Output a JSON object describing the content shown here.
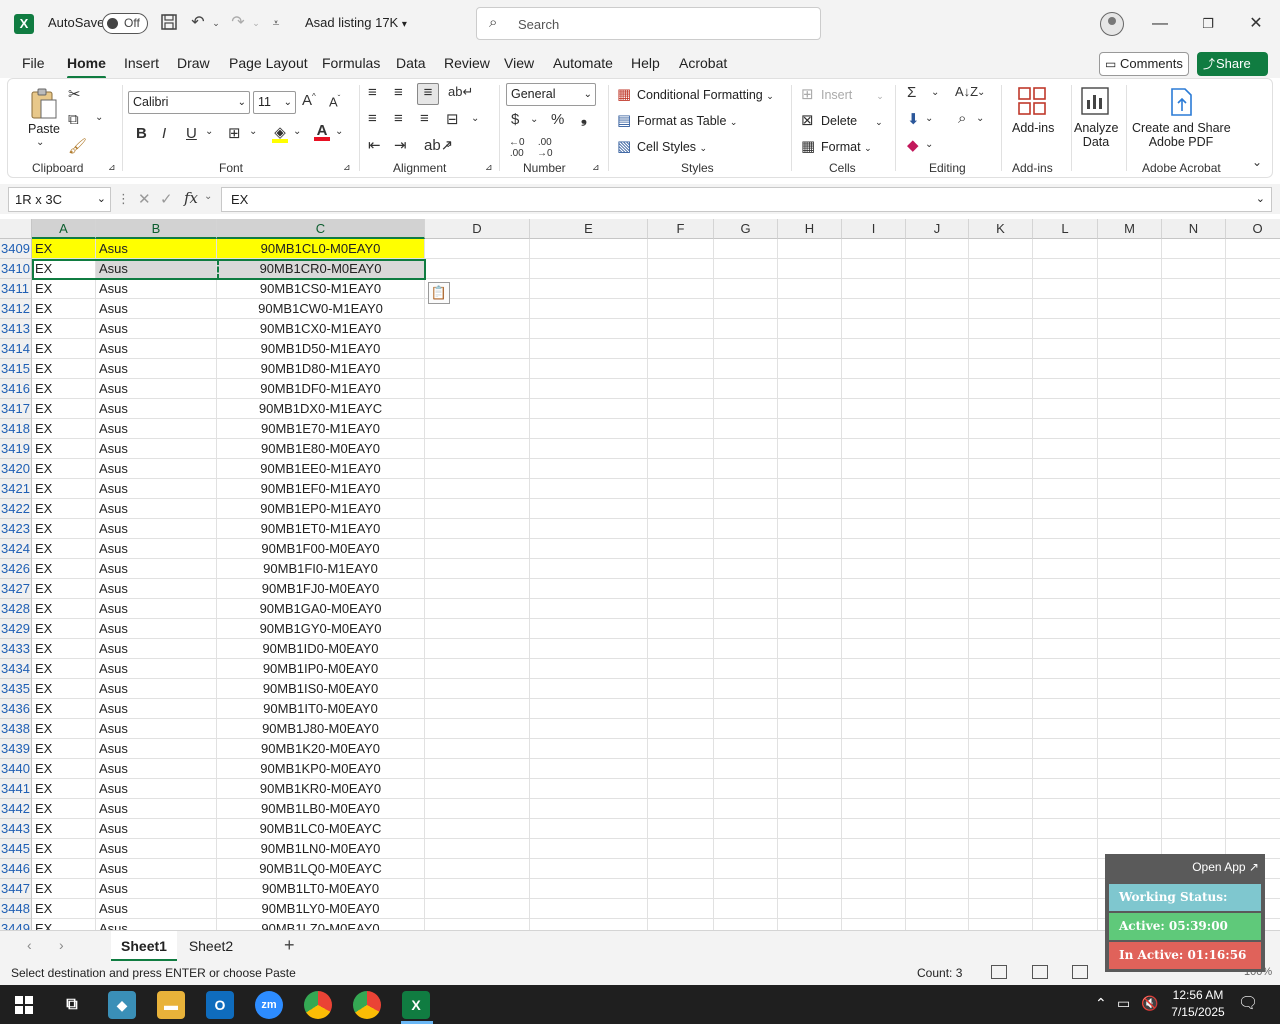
{
  "titlebar": {
    "autosave_label": "AutoSave",
    "autosave_state": "Off",
    "doc_title": "Asad listing 17K",
    "search_placeholder": "Search"
  },
  "menu": {
    "tabs": [
      "File",
      "Home",
      "Insert",
      "Draw",
      "Page Layout",
      "Formulas",
      "Data",
      "Review",
      "View",
      "Automate",
      "Help",
      "Acrobat"
    ],
    "active_tab": "Home",
    "comments_label": "Comments",
    "share_label": "Share"
  },
  "ribbon": {
    "clipboard": {
      "paste_label": "Paste",
      "group_label": "Clipboard"
    },
    "font": {
      "font_name": "Calibri",
      "font_size": "11",
      "group_label": "Font"
    },
    "alignment": {
      "group_label": "Alignment"
    },
    "number": {
      "format": "General",
      "group_label": "Number"
    },
    "styles": {
      "conditional": "Conditional Formatting",
      "format_table": "Format as Table",
      "cell_styles": "Cell Styles",
      "group_label": "Styles"
    },
    "cells": {
      "insert": "Insert",
      "delete": "Delete",
      "format": "Format",
      "group_label": "Cells"
    },
    "editing": {
      "group_label": "Editing"
    },
    "addins": {
      "label": "Add-ins",
      "group_label": "Add-ins"
    },
    "analyze": {
      "label_line1": "Analyze",
      "label_line2": "Data"
    },
    "acrobat": {
      "label_line1": "Create and Share",
      "label_line2": "Adobe PDF",
      "group_label": "Adobe Acrobat"
    }
  },
  "formula_bar": {
    "name_box": "1R x 3C",
    "fx": "fx",
    "value": "EX"
  },
  "columns": [
    "A",
    "B",
    "C",
    "D",
    "E",
    "F",
    "G",
    "H",
    "I",
    "J",
    "K",
    "L",
    "M",
    "N",
    "O"
  ],
  "rows": [
    {
      "n": "3409",
      "a": "EX",
      "b": "Asus",
      "c": "90MB1CL0-M0EAY0"
    },
    {
      "n": "3410",
      "a": "EX",
      "b": "Asus",
      "c": "90MB1CR0-M0EAY0"
    },
    {
      "n": "3411",
      "a": "EX",
      "b": "Asus",
      "c": "90MB1CS0-M1EAY0"
    },
    {
      "n": "3412",
      "a": "EX",
      "b": "Asus",
      "c": "90MB1CW0-M1EAY0"
    },
    {
      "n": "3413",
      "a": "EX",
      "b": "Asus",
      "c": "90MB1CX0-M1EAY0"
    },
    {
      "n": "3414",
      "a": "EX",
      "b": "Asus",
      "c": "90MB1D50-M1EAY0"
    },
    {
      "n": "3415",
      "a": "EX",
      "b": "Asus",
      "c": "90MB1D80-M1EAY0"
    },
    {
      "n": "3416",
      "a": "EX",
      "b": "Asus",
      "c": "90MB1DF0-M1EAY0"
    },
    {
      "n": "3417",
      "a": "EX",
      "b": "Asus",
      "c": "90MB1DX0-M1EAYC"
    },
    {
      "n": "3418",
      "a": "EX",
      "b": "Asus",
      "c": "90MB1E70-M1EAY0"
    },
    {
      "n": "3419",
      "a": "EX",
      "b": "Asus",
      "c": "90MB1E80-M0EAY0"
    },
    {
      "n": "3420",
      "a": "EX",
      "b": "Asus",
      "c": "90MB1EE0-M1EAY0"
    },
    {
      "n": "3421",
      "a": "EX",
      "b": "Asus",
      "c": "90MB1EF0-M1EAY0"
    },
    {
      "n": "3422",
      "a": "EX",
      "b": "Asus",
      "c": "90MB1EP0-M1EAY0"
    },
    {
      "n": "3423",
      "a": "EX",
      "b": "Asus",
      "c": "90MB1ET0-M1EAY0"
    },
    {
      "n": "3424",
      "a": "EX",
      "b": "Asus",
      "c": "90MB1F00-M0EAY0"
    },
    {
      "n": "3426",
      "a": "EX",
      "b": "Asus",
      "c": "90MB1FI0-M1EAY0"
    },
    {
      "n": "3427",
      "a": "EX",
      "b": "Asus",
      "c": "90MB1FJ0-M0EAY0"
    },
    {
      "n": "3428",
      "a": "EX",
      "b": "Asus",
      "c": "90MB1GA0-M0EAY0"
    },
    {
      "n": "3429",
      "a": "EX",
      "b": "Asus",
      "c": "90MB1GY0-M0EAY0"
    },
    {
      "n": "3433",
      "a": "EX",
      "b": "Asus",
      "c": "90MB1ID0-M0EAY0"
    },
    {
      "n": "3434",
      "a": "EX",
      "b": "Asus",
      "c": "90MB1IP0-M0EAY0"
    },
    {
      "n": "3435",
      "a": "EX",
      "b": "Asus",
      "c": "90MB1IS0-M0EAY0"
    },
    {
      "n": "3436",
      "a": "EX",
      "b": "Asus",
      "c": "90MB1IT0-M0EAY0"
    },
    {
      "n": "3438",
      "a": "EX",
      "b": "Asus",
      "c": "90MB1J80-M0EAY0"
    },
    {
      "n": "3439",
      "a": "EX",
      "b": "Asus",
      "c": "90MB1K20-M0EAY0"
    },
    {
      "n": "3440",
      "a": "EX",
      "b": "Asus",
      "c": "90MB1KP0-M0EAY0"
    },
    {
      "n": "3441",
      "a": "EX",
      "b": "Asus",
      "c": "90MB1KR0-M0EAY0"
    },
    {
      "n": "3442",
      "a": "EX",
      "b": "Asus",
      "c": "90MB1LB0-M0EAY0"
    },
    {
      "n": "3443",
      "a": "EX",
      "b": "Asus",
      "c": "90MB1LC0-M0EAYC"
    },
    {
      "n": "3445",
      "a": "EX",
      "b": "Asus",
      "c": "90MB1LN0-M0EAY0"
    },
    {
      "n": "3446",
      "a": "EX",
      "b": "Asus",
      "c": "90MB1LQ0-M0EAYC"
    },
    {
      "n": "3447",
      "a": "EX",
      "b": "Asus",
      "c": "90MB1LT0-M0EAY0"
    },
    {
      "n": "3448",
      "a": "EX",
      "b": "Asus",
      "c": "90MB1LY0-M0EAY0"
    },
    {
      "n": "3449",
      "a": "EX",
      "b": "Asus",
      "c": "90MB1LZ0-M0EAY0"
    }
  ],
  "highlight_row": "3409",
  "selected_row": "3410",
  "highlight_color": "#ffff00",
  "accent_color": "#107c41",
  "sheets": {
    "tabs": [
      "Sheet1",
      "Sheet2"
    ],
    "active": "Sheet1"
  },
  "status": {
    "message": "Select destination and press ENTER or choose Paste",
    "count": "Count: 3",
    "zoom": "100%"
  },
  "widget": {
    "open_app": "Open App ↗",
    "working": "Working Status: Active",
    "active": "Active: 05:39:00",
    "inactive": "In Active: 01:16:56",
    "working_color": "#7fc7cf",
    "active_color": "#5fc97a",
    "inactive_color": "#e0625a"
  },
  "taskbar": {
    "time": "12:56 AM",
    "date": "7/15/2025"
  }
}
